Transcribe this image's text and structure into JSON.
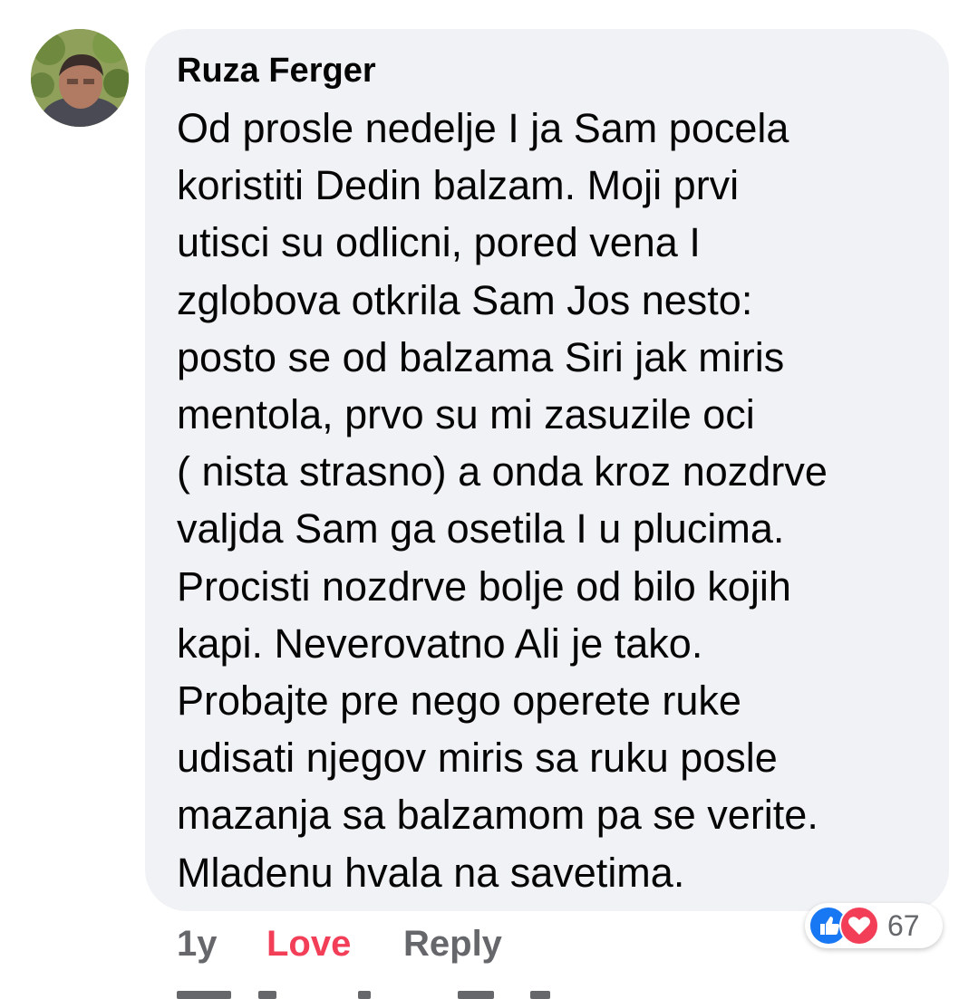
{
  "comment": {
    "author": "Ruza Ferger",
    "lines": [
      "Od prosle nedelje I ja Sam pocela",
      "koristiti Dedin balzam. Moji prvi",
      "utisci su odlicni, pored vena I",
      "zglobova otkrila Sam Jos nesto:",
      "posto se od balzama Siri jak miris",
      "mentola, prvo su mi zasuzile oci",
      "( nista strasno) a onda kroz nozdrve",
      "valjda Sam ga osetila I u plucima.",
      "Procisti nozdrve bolje od bilo kojih",
      "kapi. Neverovatno Ali je tako.",
      "Probajte pre nego operete ruke",
      "udisati njegov miris sa ruku posle",
      "mazanja sa balzamom pa se verite.",
      "Mladenu hvala na savetima."
    ]
  },
  "actions": {
    "time": "1y",
    "love": "Love",
    "reply": "Reply"
  },
  "reactions": {
    "icons": [
      "like-icon",
      "heart-icon"
    ],
    "count": "67"
  },
  "colors": {
    "bubble": "#f0f2f5",
    "love": "#f33e58",
    "like": "#1877f2",
    "muted": "#65676b"
  }
}
